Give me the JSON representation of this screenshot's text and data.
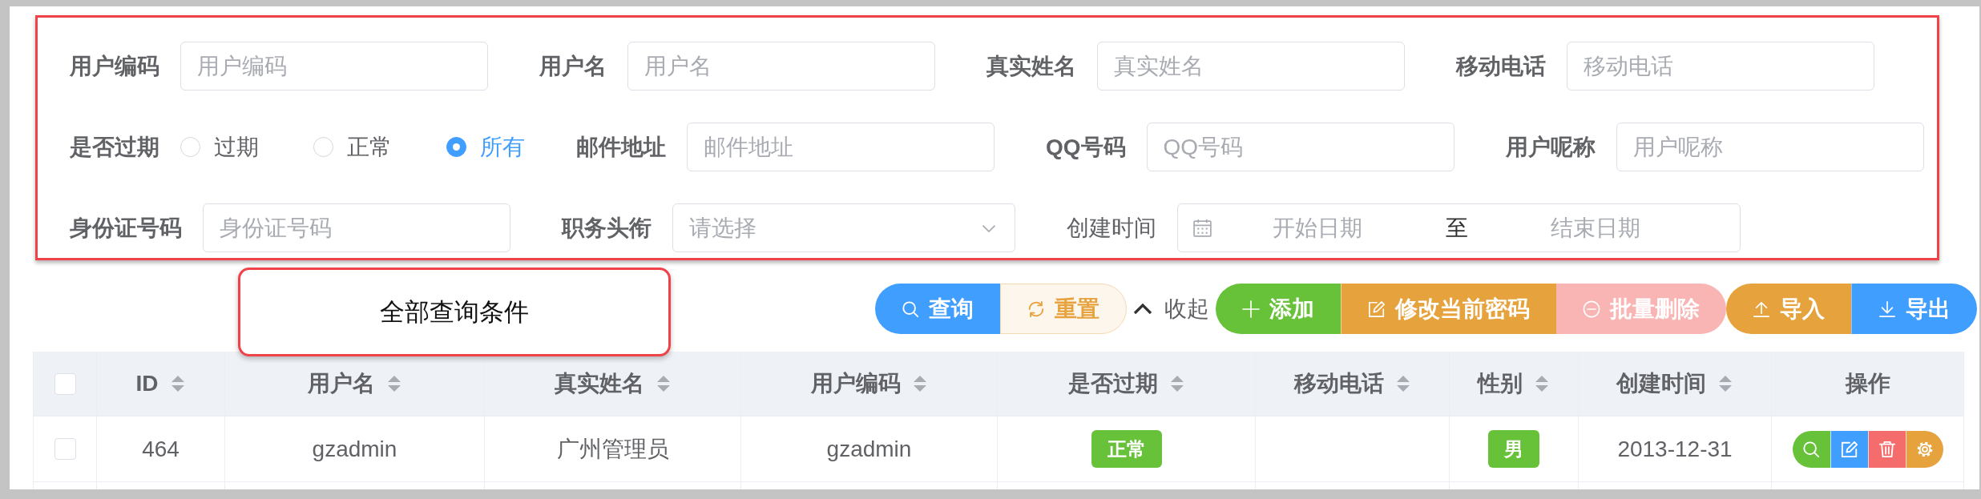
{
  "search_form": {
    "rows": [
      {
        "fields": [
          {
            "kind": "text",
            "label": "用户编码",
            "placeholder": "用户编码"
          },
          {
            "kind": "text",
            "label": "用户名",
            "placeholder": "用户名"
          },
          {
            "kind": "text",
            "label": "真实姓名",
            "placeholder": "真实姓名"
          },
          {
            "kind": "text",
            "label": "移动电话",
            "placeholder": "移动电话"
          }
        ]
      },
      {
        "fields": [
          {
            "kind": "radio",
            "label": "是否过期",
            "options": [
              {
                "label": "过期",
                "selected": false
              },
              {
                "label": "正常",
                "selected": false
              },
              {
                "label": "所有",
                "selected": true
              }
            ]
          },
          {
            "kind": "text",
            "label": "邮件地址",
            "placeholder": "邮件地址"
          },
          {
            "kind": "text",
            "label": "QQ号码",
            "placeholder": "QQ号码"
          },
          {
            "kind": "text",
            "label": "用户呢称",
            "placeholder": "用户呢称"
          }
        ]
      },
      {
        "fields": [
          {
            "kind": "text",
            "label": "身份证号码",
            "placeholder": "身份证号码"
          },
          {
            "kind": "select",
            "label": "职务头衔",
            "placeholder": "请选择"
          },
          {
            "kind": "daterange",
            "label": "创建时间",
            "start_placeholder": "开始日期",
            "separator": "至",
            "end_placeholder": "结束日期"
          }
        ]
      }
    ]
  },
  "annotation": {
    "callout": "全部查询条件"
  },
  "toolbar": {
    "search_buttons": [
      {
        "kind": "query",
        "label": "查询",
        "disabled": false
      },
      {
        "kind": "reset",
        "label": "重置",
        "disabled": false
      }
    ],
    "collapse_toggle": {
      "label": "收起",
      "expanded": true
    },
    "action_buttons": [
      {
        "kind": "add",
        "label": "添加",
        "disabled": false
      },
      {
        "kind": "edit",
        "label": "修改当前密码",
        "disabled": false
      },
      {
        "kind": "delete",
        "label": "批量删除",
        "disabled": true
      },
      {
        "kind": "import",
        "label": "导入",
        "disabled": false
      },
      {
        "kind": "export",
        "label": "导出",
        "disabled": false
      }
    ]
  },
  "table": {
    "select_all": {
      "checked": false
    },
    "columns": [
      {
        "label": "ID",
        "sortable": true
      },
      {
        "label": "用户名",
        "sortable": true
      },
      {
        "label": "真实姓名",
        "sortable": true
      },
      {
        "label": "用户编码",
        "sortable": true
      },
      {
        "label": "是否过期",
        "sortable": true
      },
      {
        "label": "移动电话",
        "sortable": true
      },
      {
        "label": "性别",
        "sortable": true
      },
      {
        "label": "创建时间",
        "sortable": true
      },
      {
        "label": "操作",
        "sortable": false
      }
    ],
    "rows": [
      {
        "checked": false,
        "cells": [
          {
            "kind": "text",
            "text": "464"
          },
          {
            "kind": "text",
            "text": "gzadmin"
          },
          {
            "kind": "text",
            "text": "广州管理员"
          },
          {
            "kind": "text",
            "text": "gzadmin"
          },
          {
            "kind": "tag",
            "text": "正常"
          },
          {
            "kind": "empty"
          },
          {
            "kind": "tag",
            "text": "男"
          },
          {
            "kind": "text",
            "text": "2013-12-31"
          },
          {
            "kind": "actions",
            "buttons": [
              {
                "kind": "view"
              },
              {
                "kind": "edit"
              },
              {
                "kind": "delete"
              },
              {
                "kind": "settings"
              }
            ]
          }
        ]
      }
    ]
  }
}
